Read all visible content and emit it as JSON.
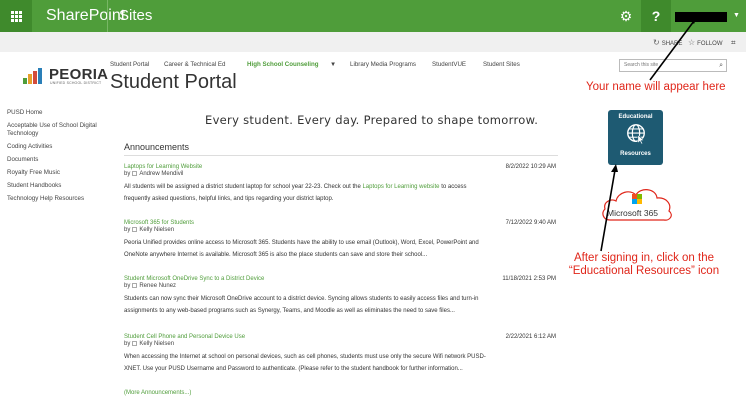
{
  "suite": {
    "app_name": "SharePoint",
    "section": "Sites",
    "settings_icon": "gear-icon",
    "help_label": "?"
  },
  "actions": {
    "share": "SHARE",
    "follow": "FOLLOW"
  },
  "logo": {
    "name": "PEORIA",
    "sub": "UNIFIED SCHOOL DISTRICT"
  },
  "topnav": [
    "Student Portal",
    "Career & Technical Ed",
    "High School Counseling",
    "Library Media Programs",
    "StudentVUE",
    "Student Sites"
  ],
  "site_title": "Student Portal",
  "search": {
    "placeholder": "Search this site"
  },
  "leftnav": [
    "PUSD Home",
    "Acceptable Use of School Digital Technology",
    "Coding Activities",
    "Documents",
    "Royalty Free Music",
    "Student Handbooks",
    "Technology Help Resources"
  ],
  "tagline": "Every student. Every day. Prepared to shape tomorrow.",
  "announcements": {
    "heading": "Announcements",
    "items": [
      {
        "title": "Laptops for Learning Website",
        "date": "8/2/2022 10:29 AM",
        "by_prefix": "by",
        "author": "Andrew Mendivil",
        "line1_a": "All students will be assigned a district student laptop for school year 22-23. Check out the ",
        "line1_link": "Laptops for Learning website",
        "line1_b": " to access",
        "line2": "frequently asked questions, helpful links, and tips regarding your district laptop."
      },
      {
        "title": "Microsoft 365 for Students",
        "date": "7/12/2022 9:40 AM",
        "by_prefix": "by",
        "author": "Kelly Nielsen",
        "line1": "Peoria Unified provides online access to Microsoft 365. Students have the ability to use email (Outlook), Word, Excel, PowerPoint and",
        "line2": "OneNote anywhere Internet is available. Microsoft 365 is also the place students can save and store their school..."
      },
      {
        "title": "Student Microsoft OneDrive Sync to a District Device",
        "date": "11/18/2021 2:53 PM",
        "by_prefix": "by",
        "author": "Renee Nunez",
        "line1": "Students can now sync their Microsoft OneDrive account to a district device. Syncing allows students to easily access files and turn-in",
        "line2": "assignments to any web-based programs such as Synergy, Teams, and Moodle as well as eliminates the need to save files..."
      },
      {
        "title": "Student Cell Phone and Personal Device Use",
        "date": "2/22/2021 6:12 AM",
        "by_prefix": "by",
        "author": "Kelly Nielsen",
        "line1": "When accessing the Internet at school on personal devices, such as cell phones, students must use only the secure Wifi network PUSD-",
        "line2": "XNET. Use your PUSD Username and Password to authenticate. (Please refer to the student handbook for further information..."
      }
    ],
    "more": "(More Announcements...)"
  },
  "tile": {
    "top": "Educational",
    "bottom": "Resources"
  },
  "ms365": {
    "label": "Microsoft 365"
  },
  "notes": {
    "name_note": "Your name will appear here",
    "resources_note_1": "After signing in, click on the",
    "resources_note_2": "“Educational Resources” icon"
  },
  "colors": {
    "accent": "#4f9d3a",
    "tile": "#1e5a72",
    "note": "#e0261a"
  }
}
